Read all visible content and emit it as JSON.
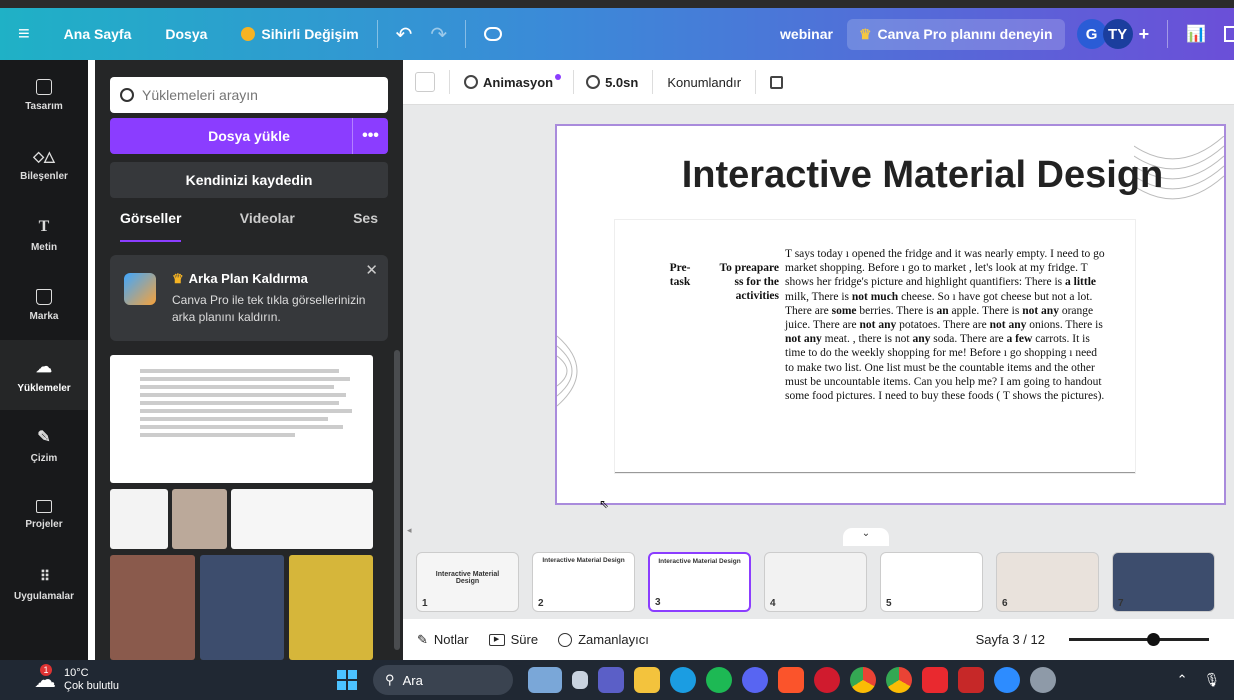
{
  "topbar": {
    "home": "Ana Sayfa",
    "file": "Dosya",
    "magic": "Sihirli Değişim",
    "doc_title": "webinar",
    "pro_cta": "Canva Pro planını deneyin",
    "avatar_g": "G",
    "avatar_ty": "TY",
    "add": "+"
  },
  "rail": [
    {
      "label": "Tasarım"
    },
    {
      "label": "Bileşenler"
    },
    {
      "label": "Metin"
    },
    {
      "label": "Marka"
    },
    {
      "label": "Yüklemeler"
    },
    {
      "label": "Çizim"
    },
    {
      "label": "Projeler"
    },
    {
      "label": "Uygulamalar"
    }
  ],
  "panel": {
    "search_placeholder": "Yüklemeleri arayın",
    "upload": "Dosya yükle",
    "upload_more": "•••",
    "record": "Kendinizi kaydedin",
    "tabs": [
      "Görseller",
      "Videolar",
      "Ses"
    ],
    "promo_title": "Arka Plan Kaldırma",
    "promo_text": "Canva Pro ile tek tıkla görsellerinizin arka planını kaldırın."
  },
  "toolbar": {
    "animation": "Animasyon",
    "duration": "5.0sn",
    "position": "Konumlandır"
  },
  "slide": {
    "title": "Interactive Material Design",
    "col1": "Pre-\ntask",
    "col2": "To preapare ss for the activities",
    "body_parts": [
      "T says today ı opened the fridge and it was nearly empty. I need to go market shopping. Before ı go to market , let's look at my fridge. T shows her fridge's picture and highlight quantifiers: There is ",
      "a little",
      " milk, There is ",
      "not much",
      " cheese. So ı have got cheese but not a lot. There are ",
      "some",
      " berries. There is ",
      "an",
      " apple. There is ",
      "not any",
      " orange juice. There are ",
      "not any",
      " potatoes. There are ",
      "not any",
      " onions. There is ",
      "not any",
      " meat. , there is not ",
      "any",
      " soda. There are ",
      "a few",
      " carrots. It is time to do the weekly shopping for me! Before ı go shopping ı need to make two list. One list must be the countable items and the other must be uncountable items. Can you help me? I am going to handout some food pictures. I need to buy these foods ( T shows the pictures)."
    ]
  },
  "filmstrip": [
    {
      "num": "1",
      "caption": "Interactive Material Design"
    },
    {
      "num": "2",
      "caption": "Interactive Material Design"
    },
    {
      "num": "3",
      "caption": "Interactive Material Design"
    },
    {
      "num": "4",
      "caption": ""
    },
    {
      "num": "5",
      "caption": ""
    },
    {
      "num": "6",
      "caption": ""
    },
    {
      "num": "7",
      "caption": ""
    }
  ],
  "bottombar": {
    "notes": "Notlar",
    "duration": "Süre",
    "timer": "Zamanlayıcı",
    "page": "Sayfa 3 / 12",
    "zoom_fraction": 0.6
  },
  "taskbar": {
    "temp": "10°C",
    "weather": "Çok bulutlu",
    "search": "Ara",
    "weather_badge": "1"
  },
  "colors": {
    "accent": "#8b3dff",
    "sidebar": "#18191b",
    "panel": "#252627"
  }
}
